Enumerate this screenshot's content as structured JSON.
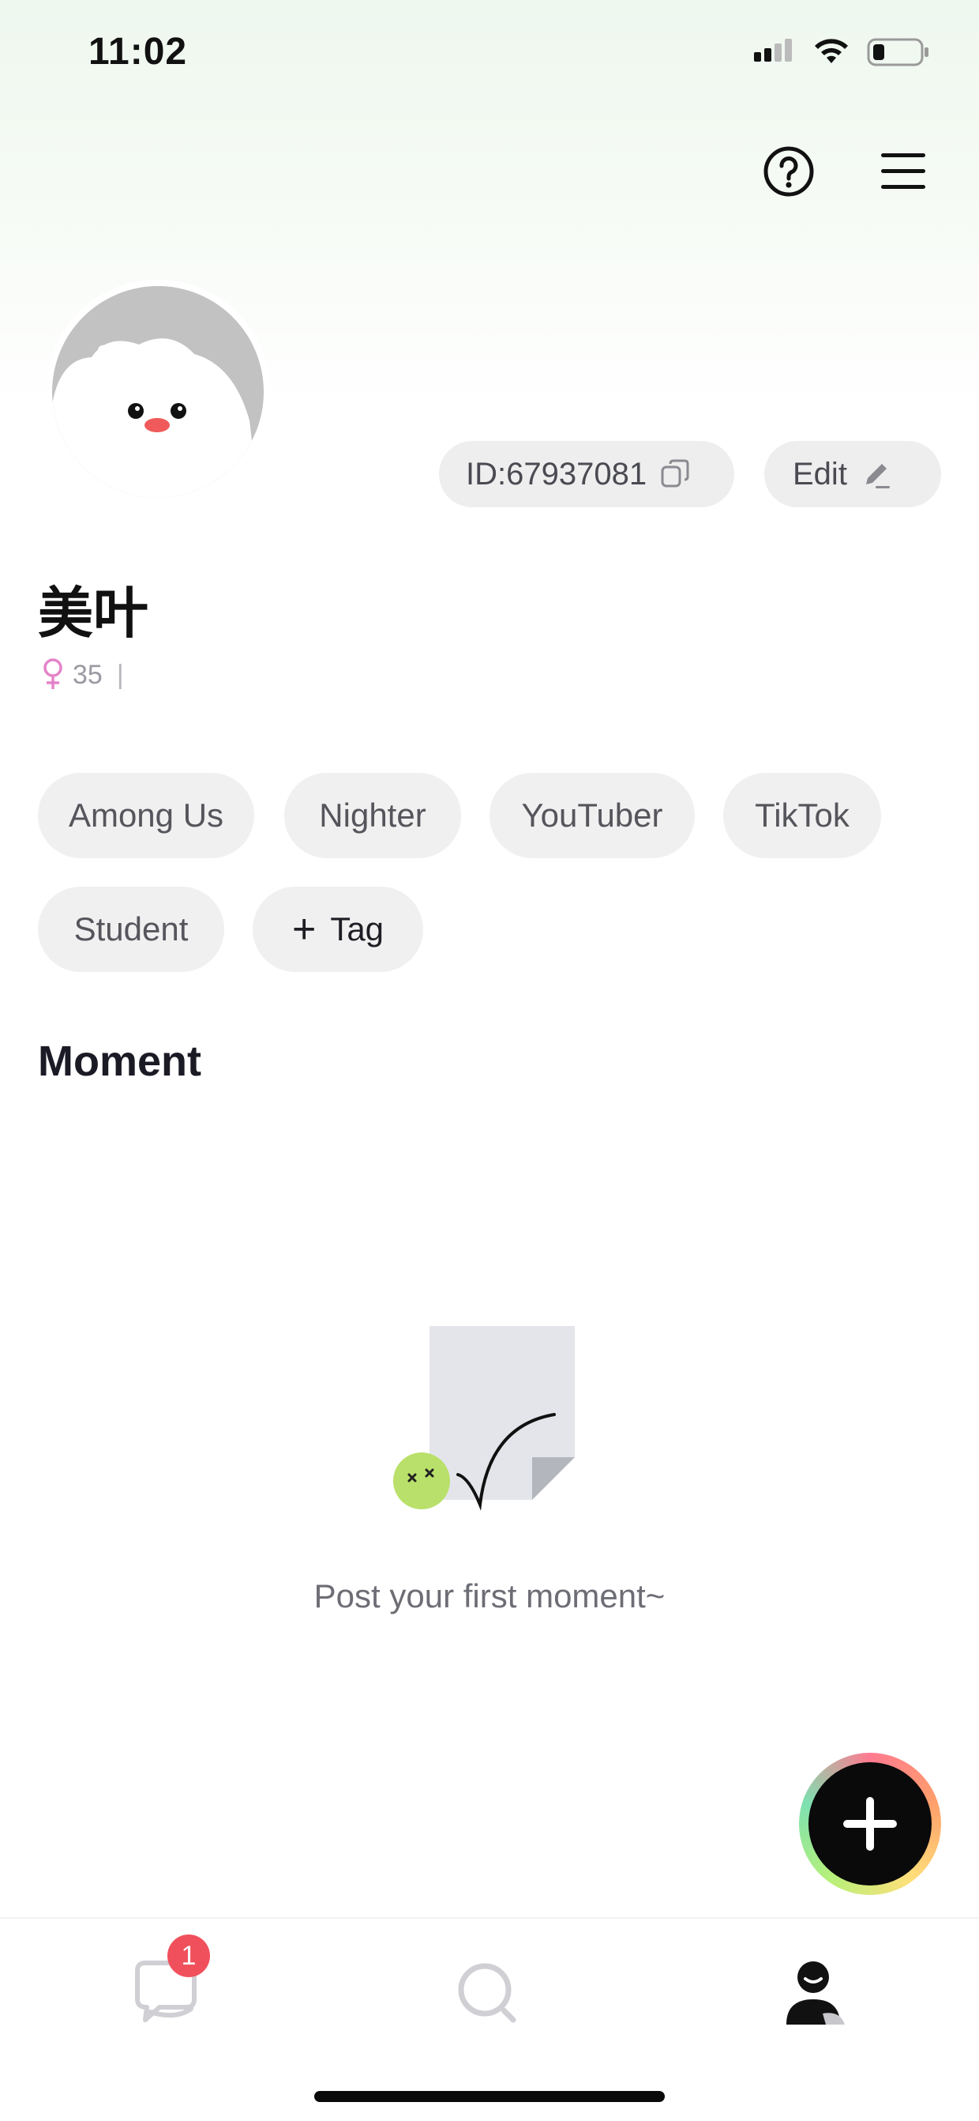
{
  "status_bar": {
    "time": "11:02"
  },
  "profile": {
    "id_label": "ID:67937081",
    "edit_label": "Edit",
    "name": "美叶",
    "age": "35",
    "separator": "|"
  },
  "tags": [
    "Among Us",
    "Nighter",
    "YouTuber",
    "TikTok",
    "Student"
  ],
  "add_tag_label": "Tag",
  "moments": {
    "title": "Moment",
    "empty_text": "Post your first moment~"
  },
  "nav": {
    "chat_badge": "1"
  },
  "colors": {
    "accent_badge": "#f0505c",
    "female_icon": "#e483c8",
    "fab": "#0a0a0a"
  }
}
